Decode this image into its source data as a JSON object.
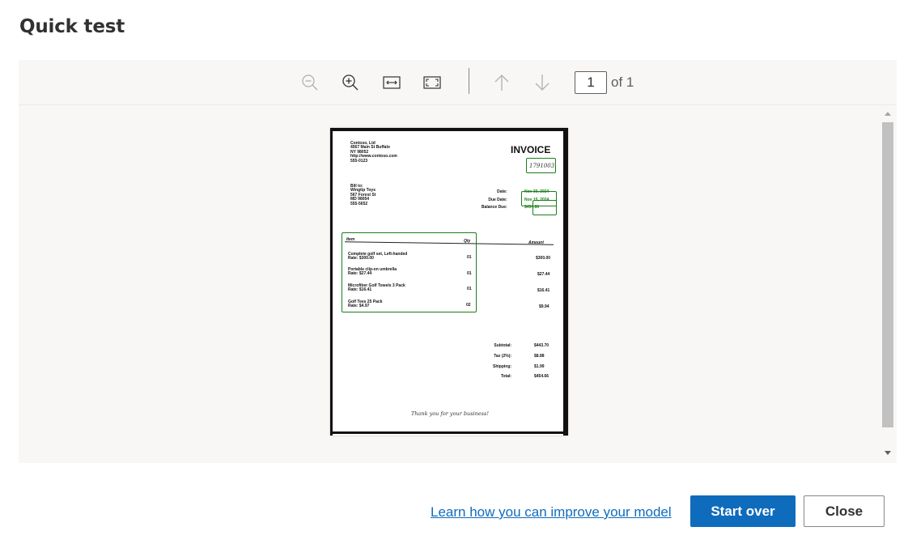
{
  "dialog": {
    "title": "Quick test"
  },
  "toolbar": {
    "zoom_out": "zoom-out-icon",
    "zoom_in": "zoom-in-icon",
    "fit_width": "fit-width-icon",
    "fit_page": "fit-page-icon",
    "prev_page": "arrow-up-icon",
    "next_page": "arrow-down-icon",
    "page_current": "1",
    "page_of": "of 1"
  },
  "invoice": {
    "company": "Contoso, Ltd\n4567 Main St Buffalo\nNY 98052\nhttp://www.contoso.com\n555-0123",
    "title": "INVOICE",
    "invoice_number": "1791003",
    "bill_to": "Bill to:\nWingtip Toys\n567 Forest St\nMD 98054\n555-5652",
    "date_labels": "Date:\nDue Date:\nBalance Due:",
    "date_values": "Nov 30, 2024\nNov 15, 2024\n$454.66",
    "col_item": "Item",
    "col_qty": "Qty",
    "col_amount": "Amount",
    "line_items": [
      {
        "desc": "Complete golf set, Left-handed\nRate: $300.00",
        "qty": "01",
        "amount": "$300.00"
      },
      {
        "desc": "Portable clip-on umbrella\nRate: $27.44",
        "qty": "01",
        "amount": "$27.44"
      },
      {
        "desc": "Microfiber Golf Towels 3 Pack\nRate: $16.41",
        "qty": "01",
        "amount": "$16.41"
      },
      {
        "desc": "Golf Tees 25 Pack\nRate: $4.97",
        "qty": "02",
        "amount": "$9.94"
      }
    ],
    "totals_labels": "Subtotal:\n\nTax (2%):\n\nShipping:\n\nTotal:",
    "totals_values": "$443.70\n\n$8.88\n\n$1.99\n\n$454.66",
    "thanks": "Thank you for your business!"
  },
  "footer": {
    "learn_link": "Learn how you can improve your model",
    "start_over": "Start over",
    "close": "Close"
  },
  "colors": {
    "accent": "#0f6cbd",
    "detection_box": "#1a7f1a",
    "viewer_bg": "#f8f7f6"
  }
}
